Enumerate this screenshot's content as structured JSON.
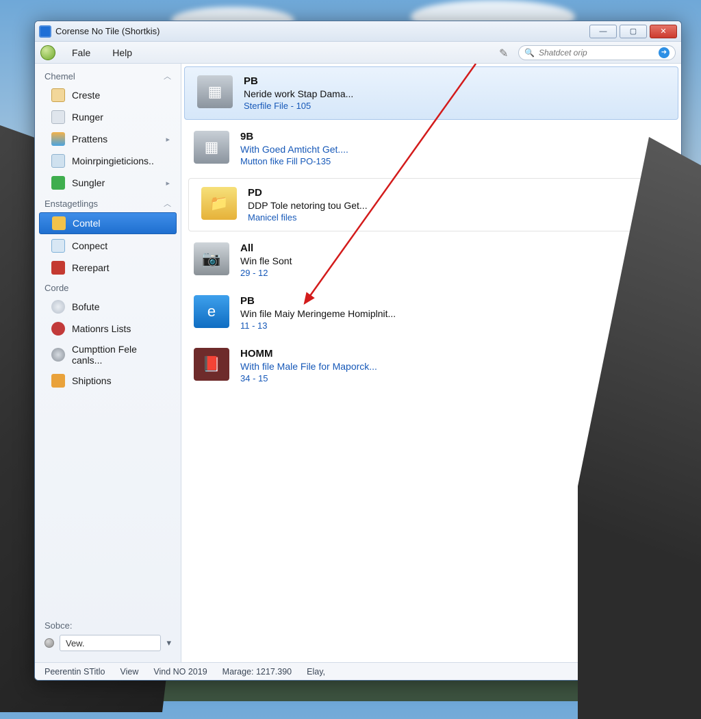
{
  "window": {
    "title": "Corense No Tile (Shortkis)"
  },
  "menu": {
    "items": [
      "Fale",
      "Help"
    ]
  },
  "search": {
    "placeholder": "Shatdcet orip"
  },
  "sidebar": {
    "groups": [
      {
        "label": "Chemel",
        "items": [
          {
            "label": "Creste",
            "icon": "#e7b564",
            "has_submenu": false
          },
          {
            "label": "Runger",
            "icon": "#b9c3cf",
            "has_submenu": false
          },
          {
            "label": "Prattens",
            "icon": "#4aa3e0",
            "has_submenu": true
          },
          {
            "label": "Moinrpingieticions..",
            "icon": "#8bb6d9",
            "has_submenu": false
          },
          {
            "label": "Sungler",
            "icon": "#3fae4e",
            "has_submenu": true
          }
        ]
      },
      {
        "label": "Enstagetlings",
        "items": [
          {
            "label": "Contel",
            "icon": "#f2c24b",
            "selected": true
          },
          {
            "label": "Conpect",
            "icon": "#5aa0d8"
          },
          {
            "label": "Rerepart",
            "icon": "#c43a31"
          }
        ]
      },
      {
        "label": "Corde",
        "items": [
          {
            "label": "Bofute",
            "icon": "#c9cfd6"
          },
          {
            "label": "Mationrs Lists",
            "icon": "#c23a3a"
          },
          {
            "label": "Cumpttion Fele canls...",
            "icon": "#9aa1aa"
          },
          {
            "label": "Shiptions",
            "icon": "#e9a23b"
          }
        ]
      }
    ],
    "footer": {
      "label": "Sobce:",
      "value": "Vew."
    }
  },
  "list": [
    {
      "title": "PB",
      "line2": "Neride work Stap Dama...",
      "line3": "Sterfile File - 105",
      "thumb": "box",
      "selected": true,
      "line2_blue": false
    },
    {
      "title": "9B",
      "line2": "With Goed Amticht Get....",
      "line3": "Mutton fike Fill PO-135",
      "thumb": "box",
      "line2_blue": true
    },
    {
      "title": "PD",
      "line2": "DDP Tole netoring tou Get...",
      "line3": "Manicel files",
      "thumb": "folder",
      "boxed": true,
      "line2_blue": false
    },
    {
      "title": "All",
      "line2": "Win fle Sont",
      "line3": "29 - 12",
      "thumb": "camera",
      "line2_blue": false
    },
    {
      "title": "PB",
      "line2": "Win file Maiy Meringeme Homiplnit...",
      "line3": "11 - 13",
      "thumb": "blue",
      "line2_blue": false
    },
    {
      "title": "HOMM",
      "line2": "With file Male File for Maporck...",
      "line3": "34 - 15",
      "thumb": "book",
      "line2_blue": true
    }
  ],
  "status": {
    "items": [
      "Peerentin STitlo",
      "View",
      "Vind NO 2019",
      "Marage: 1217.390",
      "Elay,"
    ]
  }
}
